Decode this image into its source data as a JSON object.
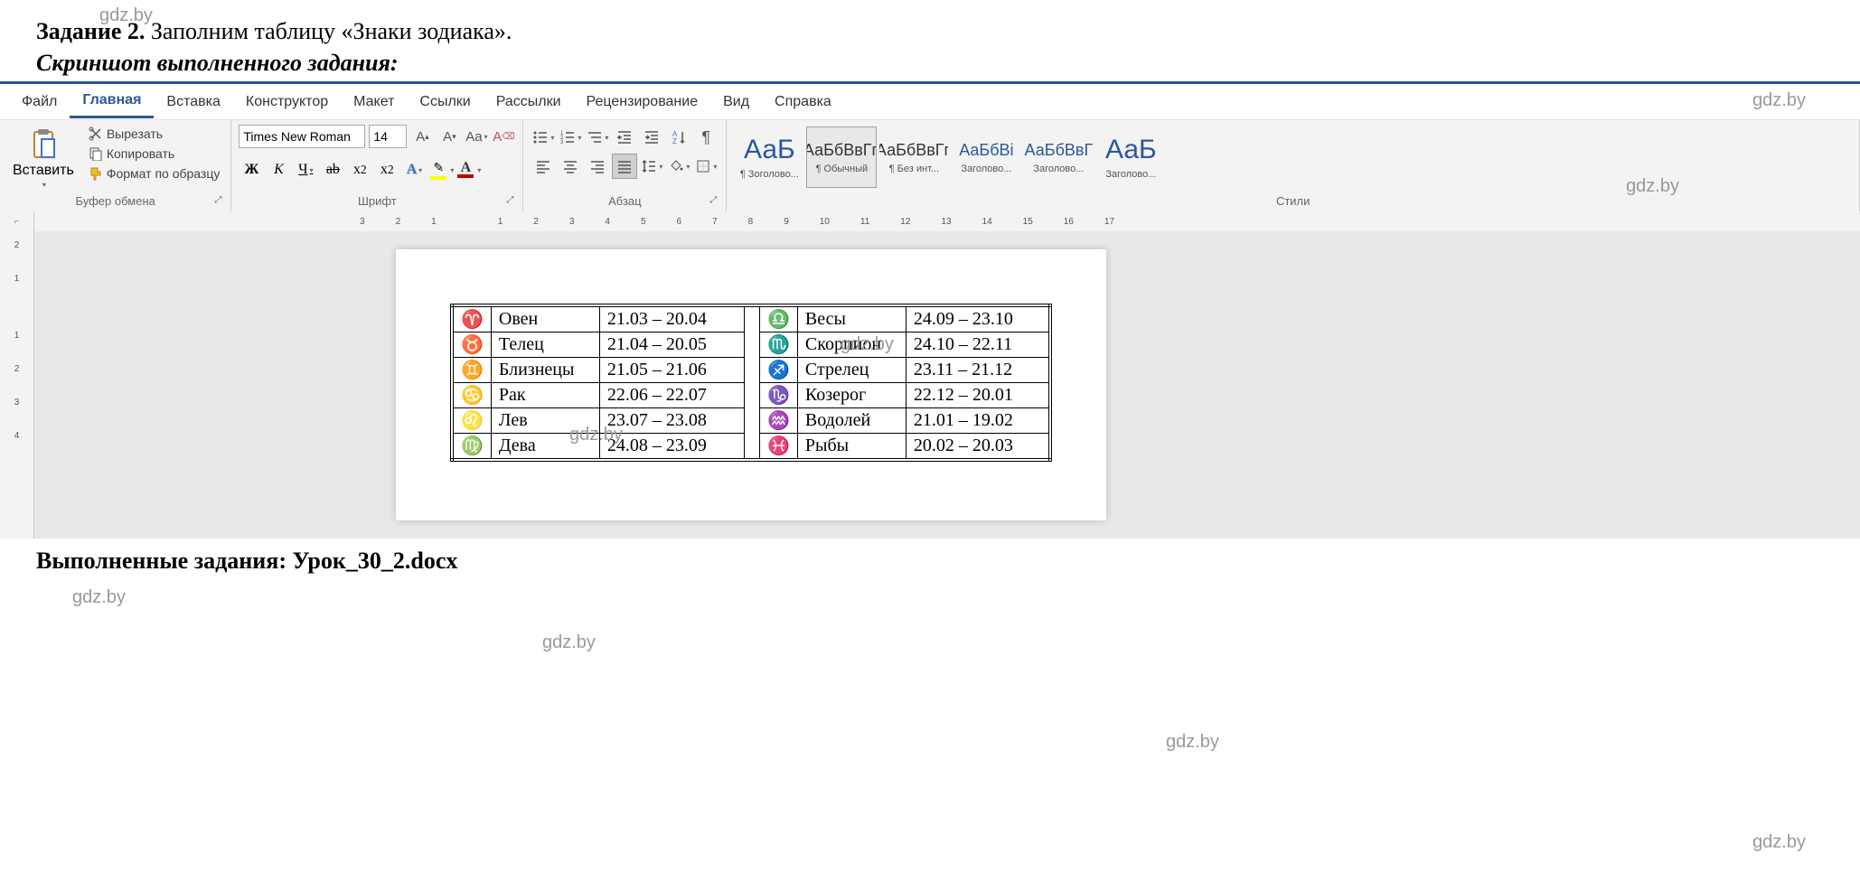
{
  "watermarks": [
    "gdz.by",
    "gdz.by",
    "gdz.by",
    "gdz.by",
    "gdz.by",
    "gdz.by",
    "gdz.by",
    "gdz.by",
    "gdz.by"
  ],
  "task_header_bold": "Задание 2.",
  "task_header_rest": " Заполним таблицу «Знаки зодиака».",
  "screenshot_label": "Скриншот выполненного задания:",
  "tabs": {
    "file": "Файл",
    "home": "Главная",
    "insert": "Вставка",
    "design": "Конструктор",
    "layout": "Макет",
    "references": "Ссылки",
    "mailings": "Рассылки",
    "review": "Рецензирование",
    "view": "Вид",
    "help": "Справка"
  },
  "clipboard": {
    "paste": "Вставить",
    "cut": "Вырезать",
    "copy": "Копировать",
    "format_painter": "Формат по образцу",
    "group_label": "Буфер обмена"
  },
  "font": {
    "font_name": "Times New Roman",
    "font_size": "14",
    "group_label": "Шрифт",
    "bold": "Ж",
    "italic": "К",
    "underline": "Ч",
    "strike": "ab",
    "sub": "x₂",
    "sup": "x²",
    "text_effect": "A",
    "highlight": "",
    "font_color": "A",
    "case": "Aa",
    "clear": "Aφ"
  },
  "paragraph": {
    "group_label": "Абзац"
  },
  "styles": {
    "group_label": "Стили",
    "preview_sample": "АаБбВвГг,",
    "preview_sample_short": "АаБбВі",
    "preview_sample_short2": "АаБбВвГ",
    "preview_big": "АаБ",
    "items": [
      {
        "name": "¶ Зоголово...",
        "preview_key": "preview_big",
        "class": "big"
      },
      {
        "name": "¶ Обычный",
        "preview_key": "preview_sample",
        "class": ""
      },
      {
        "name": "¶ Без инт...",
        "preview_key": "preview_sample",
        "class": ""
      },
      {
        "name": "Заголово...",
        "preview_key": "preview_sample_short",
        "class": "blue"
      },
      {
        "name": "Заголово...",
        "preview_key": "preview_sample_short2",
        "class": "blue"
      },
      {
        "name": "Заголово...",
        "preview_key": "preview_big",
        "class": "big"
      }
    ]
  },
  "ruler_h": [
    "3",
    "2",
    "1",
    "",
    "1",
    "2",
    "3",
    "4",
    "5",
    "6",
    "7",
    "8",
    "9",
    "10",
    "11",
    "12",
    "13",
    "14",
    "15",
    "16",
    "17"
  ],
  "ruler_v": [
    "2",
    "1",
    "",
    "1",
    "2",
    "3",
    "4"
  ],
  "zodiac": {
    "rows": [
      {
        "s1": "♈",
        "n1": "Овен",
        "d1": "21.03 – 20.04",
        "s2": "♎",
        "n2": "Весы",
        "d2": "24.09 – 23.10"
      },
      {
        "s1": "♉",
        "n1": "Телец",
        "d1": "21.04 – 20.05",
        "s2": "♏",
        "n2": "Скорпион",
        "d2": "24.10 – 22.11"
      },
      {
        "s1": "♊",
        "n1": "Близнецы",
        "d1": "21.05 – 21.06",
        "s2": "♐",
        "n2": "Стрелец",
        "d2": "23.11 – 21.12"
      },
      {
        "s1": "♋",
        "n1": "Рак",
        "d1": "22.06 – 22.07",
        "s2": "♑",
        "n2": "Козерог",
        "d2": "22.12 – 20.01"
      },
      {
        "s1": "♌",
        "n1": "Лев",
        "d1": "23.07 – 23.08",
        "s2": "♒",
        "n2": "Водолей",
        "d2": "21.01 – 19.02"
      },
      {
        "s1": "♍",
        "n1": "Дева",
        "d1": "24.08 – 23.09",
        "s2": "♓",
        "n2": "Рыбы",
        "d2": "20.02 – 20.03"
      }
    ]
  },
  "footer": "Выполненные задания: Урок_30_2.docx"
}
